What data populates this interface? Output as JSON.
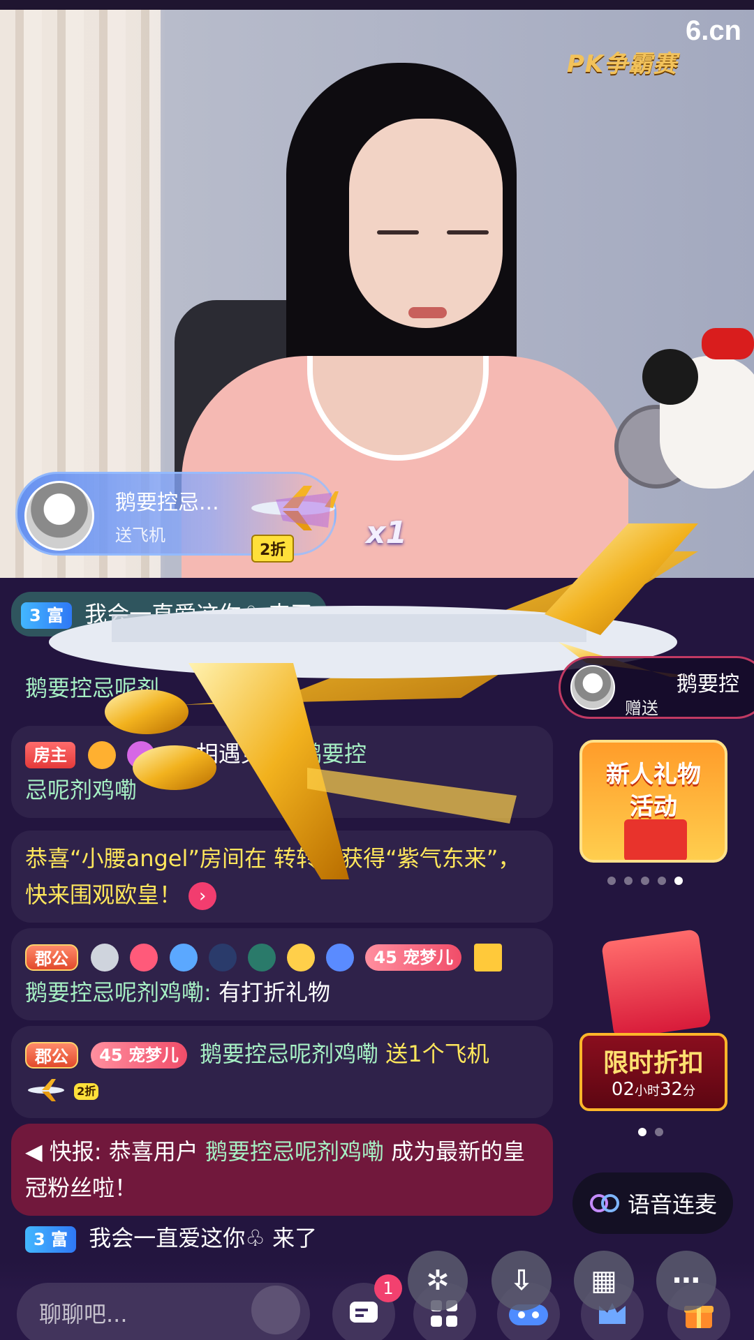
{
  "stream": {
    "brand": "6.cn",
    "pk_badge": "PK争霸赛"
  },
  "gift_banner": {
    "user": "鹅要控忌...",
    "action": "送飞机",
    "discount": "2折",
    "count": "x1"
  },
  "chat": [
    {
      "id": "join1",
      "badge": "3 富",
      "text": "我会一直爱这你♧ 来了"
    },
    {
      "id": "msg1",
      "sender": "鹅要控忌呢剂"
    },
    {
      "id": "msg2",
      "badge": "房主",
      "text_a": "… 相遇见 对",
      "target": "鹅要控",
      "text_b": "忌呢剂鸡嘞"
    },
    {
      "id": "sys1",
      "text_a": "恭喜“小腰angel”房间在",
      "text_b": "转转乐获得“紫气东来”，快来围观欧皇！"
    },
    {
      "id": "msg3",
      "badge": "郡公",
      "fan_level": "45",
      "fan_name": "宠梦儿",
      "sender": "鹅要控忌呢剂鸡嘞:",
      "text": "有打折礼物"
    },
    {
      "id": "msg4",
      "badge": "郡公",
      "fan_level": "45",
      "fan_name": "宠梦儿",
      "sender": "鹅要控忌呢剂鸡嘞",
      "text": "送1个飞机",
      "gift_tag": "2折"
    },
    {
      "id": "news",
      "prefix": "快报:",
      "text_a": "恭喜用户",
      "user": "鹅要控忌呢剂鸡嘞",
      "text_b": "成为最新的皇冠粉丝啦！"
    },
    {
      "id": "join2",
      "badge": "3 富",
      "text": "我会一直爱这你♧ 来了"
    }
  ],
  "gift_notice": {
    "user": "鹅要控",
    "action": "赠送"
  },
  "promo": {
    "line1": "新人礼物",
    "line2": "活动"
  },
  "sale": {
    "label": "限时折扣",
    "hours": "02",
    "hours_unit": "小时",
    "minutes": "32",
    "minutes_unit": "分"
  },
  "voice": {
    "label": "语音连麦"
  },
  "bottom": {
    "input_placeholder": "聊聊吧...",
    "notification_count": "1"
  },
  "colors": {
    "background": "#23153f",
    "accent_pink": "#f2416f",
    "highlight_yellow": "#ffe75c"
  }
}
